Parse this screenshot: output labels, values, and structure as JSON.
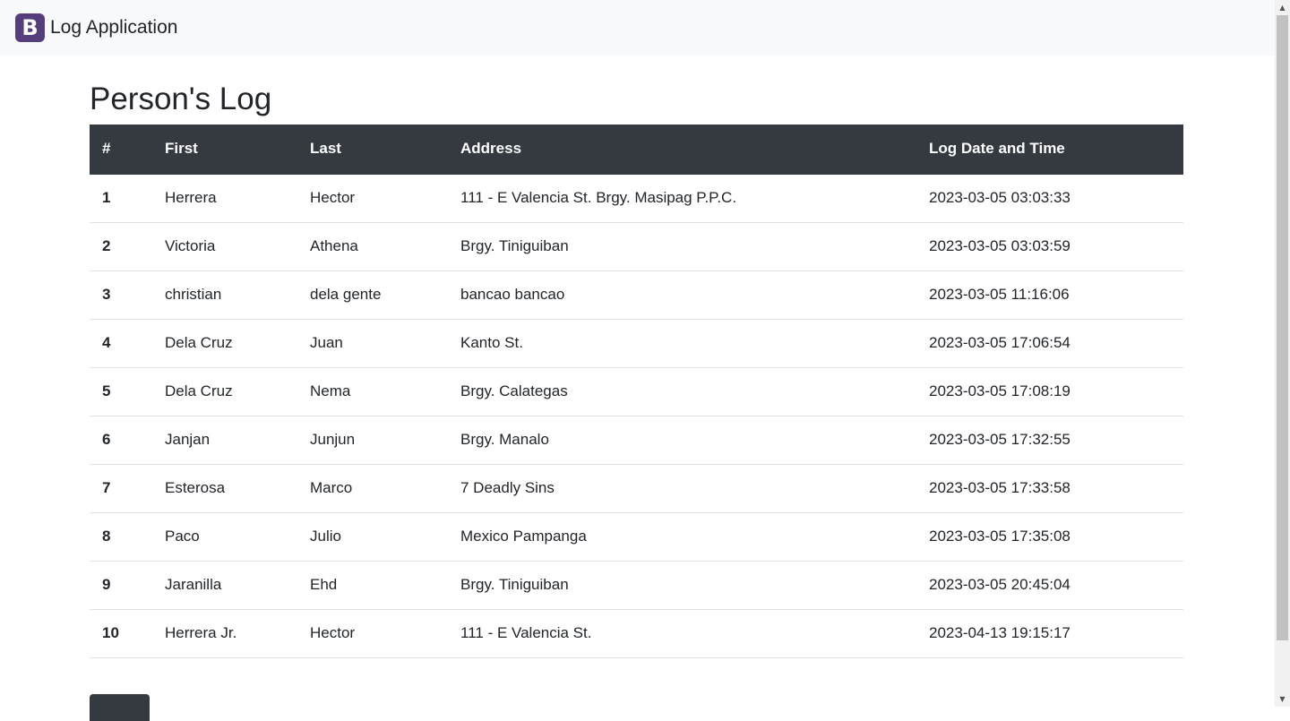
{
  "navbar": {
    "logo_letter": "B",
    "title": "Log Application",
    "logo_color": "#563d7c"
  },
  "page": {
    "title": "Person's Log"
  },
  "table": {
    "headers": [
      "#",
      "First",
      "Last",
      "Address",
      "Log Date and Time"
    ],
    "rows": [
      {
        "num": "1",
        "first": "Herrera",
        "last": "Hector",
        "address": "111 - E Valencia St. Brgy. Masipag P.P.C.",
        "log": "2023-03-05 03:03:33"
      },
      {
        "num": "2",
        "first": "Victoria",
        "last": "Athena",
        "address": "Brgy. Tiniguiban",
        "log": "2023-03-05 03:03:59"
      },
      {
        "num": "3",
        "first": "christian",
        "last": "dela gente",
        "address": "bancao bancao",
        "log": "2023-03-05 11:16:06"
      },
      {
        "num": "4",
        "first": "Dela Cruz",
        "last": "Juan",
        "address": "Kanto St.",
        "log": "2023-03-05 17:06:54"
      },
      {
        "num": "5",
        "first": "Dela Cruz",
        "last": "Nema",
        "address": "Brgy. Calategas",
        "log": "2023-03-05 17:08:19"
      },
      {
        "num": "6",
        "first": "Janjan",
        "last": "Junjun",
        "address": "Brgy. Manalo",
        "log": "2023-03-05 17:32:55"
      },
      {
        "num": "7",
        "first": "Esterosa",
        "last": "Marco",
        "address": "7 Deadly Sins",
        "log": "2023-03-05 17:33:58"
      },
      {
        "num": "8",
        "first": "Paco",
        "last": "Julio",
        "address": "Mexico Pampanga",
        "log": "2023-03-05 17:35:08"
      },
      {
        "num": "9",
        "first": "Jaranilla",
        "last": "Ehd",
        "address": "Brgy. Tiniguiban",
        "log": "2023-03-05 20:45:04"
      },
      {
        "num": "10",
        "first": "Herrera Jr.",
        "last": "Hector",
        "address": "111 - E Valencia St.",
        "log": "2023-04-13 19:15:17"
      }
    ]
  },
  "bottom_button": {
    "label": ""
  },
  "scrollbar": {
    "up_icon": "scroll-up-arrow-icon",
    "down_icon": "scroll-down-arrow-icon"
  },
  "colors": {
    "navbar_bg": "#f8f9fa",
    "table_header_bg": "#343a40",
    "row_border": "#dee2e6"
  }
}
